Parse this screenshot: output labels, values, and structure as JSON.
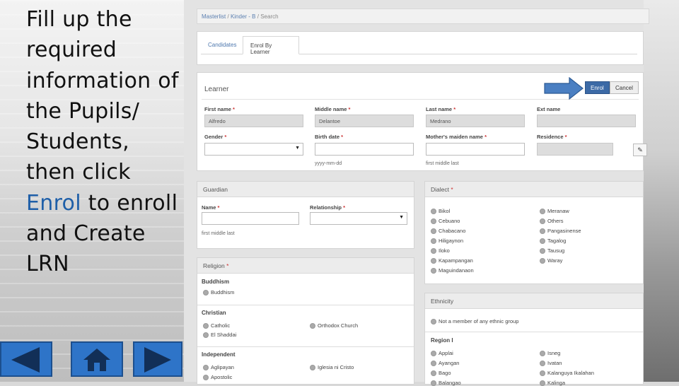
{
  "slide": {
    "instruction_part1": "Fill up the required information of the Pupils/ Students, then click ",
    "instruction_highlight": "Enrol",
    "instruction_part2": " to enroll and Create LRN"
  },
  "nav": {
    "back_icon": "left-triangle",
    "home_icon": "house",
    "forward_icon": "right-triangle"
  },
  "breadcrumb": {
    "item1": "Masterlist",
    "sep": "/",
    "item2": "Kinder - B",
    "item3": "Search"
  },
  "tabs": {
    "candidates": "Candidates",
    "enrol_by_learner": "Enrol By Learner"
  },
  "learner": {
    "title": "Learner",
    "enrol_button": "Enrol",
    "cancel_button": "Cancel",
    "fields": {
      "first_name": {
        "label": "First name",
        "value": "Alfredo"
      },
      "middle_name": {
        "label": "Middle name",
        "value": "Delantoe"
      },
      "last_name": {
        "label": "Last name",
        "value": "Medrano"
      },
      "ext_name": {
        "label": "Ext name",
        "value": ""
      },
      "gender": {
        "label": "Gender",
        "value": ""
      },
      "birth_date": {
        "label": "Birth date",
        "value": "",
        "hint": "yyyy-mm-dd"
      },
      "mothers_maiden_name": {
        "label": "Mother's maiden name",
        "value": "",
        "hint": "first middle last"
      },
      "residence": {
        "label": "Residence",
        "value": ""
      }
    },
    "required_mark": "*"
  },
  "guardian": {
    "title": "Guardian",
    "name_label": "Name",
    "relationship_label": "Relationship",
    "name_hint": "first middle last"
  },
  "dialect": {
    "title": "Dialect",
    "col1": [
      "Bikol",
      "Cebuano",
      "Chabacano",
      "Hiligaynon",
      "Iloko",
      "Kapampangan",
      "Maguindanaon"
    ],
    "col2": [
      "Meranaw",
      "Others",
      "Pangasinense",
      "Tagalog",
      "Tausug",
      "Waray"
    ]
  },
  "religion": {
    "title": "Religion",
    "groups": {
      "buddhism": {
        "title": "Buddhism",
        "items": [
          "Buddhism"
        ]
      },
      "christian": {
        "title": "Christian",
        "col1": [
          "Catholic",
          "El Shaddai"
        ],
        "col2": [
          "Orthodox Church"
        ]
      },
      "independent": {
        "title": "Independent",
        "col1": [
          "Aglipayan",
          "Apostolic"
        ],
        "col2": [
          "Iglesia ni Cristo"
        ]
      }
    }
  },
  "ethnicity": {
    "title": "Ethnicity",
    "not_member": "Not a member of any ethnic group",
    "region_title": "Region I",
    "col1": [
      "Applai",
      "Ayangan",
      "Bago",
      "Balangao"
    ],
    "col2": [
      "Isneg",
      "Ivatan",
      "Kalanguya Ikalahan",
      "Kalinga"
    ]
  }
}
